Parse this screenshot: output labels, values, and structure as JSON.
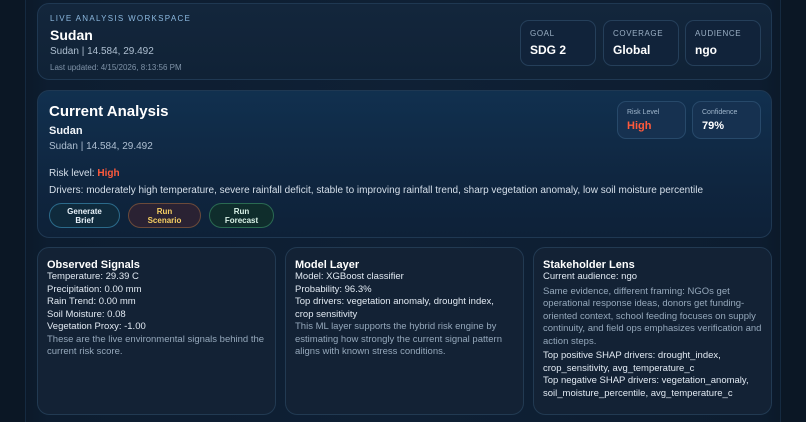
{
  "workspace": {
    "eyebrow": "LIVE ANALYSIS WORKSPACE",
    "title": "Sudan",
    "subtitle": "Sudan | 14.584, 29.492",
    "updated": "Last updated: 4/15/2026, 8:13:56 PM",
    "stats": [
      {
        "label": "GOAL",
        "value": "SDG 2"
      },
      {
        "label": "COVERAGE",
        "value": "Global"
      },
      {
        "label": "AUDIENCE",
        "value": "ngo"
      }
    ]
  },
  "analysis": {
    "title": "Current Analysis",
    "region": "Sudan",
    "subtitle": "Sudan | 14.584, 29.492",
    "risk_prefix": "Risk level: ",
    "risk_value": "High",
    "drivers": "Drivers: moderately high temperature, severe rainfall deficit, stable to improving rainfall trend, sharp vegetation anomaly, low soil moisture percentile",
    "risk_card": {
      "label": "Risk Level",
      "value": "High"
    },
    "confidence_card": {
      "label": "Confidence",
      "value": "79%"
    },
    "buttons": {
      "brief": "Generate Brief",
      "scenario": "Run Scenario",
      "forecast": "Run Forecast"
    }
  },
  "observed": {
    "title": "Observed Signals",
    "lines": [
      "Temperature: 29.39 C",
      "Precipitation: 0.00 mm",
      "Rain Trend: 0.00 mm",
      "Soil Moisture: 0.08",
      "Vegetation Proxy: -1.00"
    ],
    "note": "These are the live environmental signals behind the current risk score."
  },
  "model": {
    "title": "Model Layer",
    "model": "Model: XGBoost classifier",
    "probability": "Probability: 96.3%",
    "top_drivers": "Top drivers: vegetation anomaly, drought index, crop sensitivity",
    "note": "This ML layer supports the hybrid risk engine by estimating how strongly the current signal pattern aligns with known stress conditions."
  },
  "stakeholder": {
    "title": "Stakeholder Lens",
    "audience": "Current audience: ngo",
    "note": "Same evidence, different framing: NGOs get operational response ideas, donors get funding-oriented context, school feeding focuses on supply continuity, and field ops emphasizes verification and action steps.",
    "positive": "Top positive SHAP drivers: drought_index, crop_sensitivity, avg_temperature_c",
    "negative": "Top negative SHAP drivers: vegetation_anomaly, soil_moisture_percentile, avg_temperature_c"
  },
  "colors": {
    "risk_high": "#ff5a3c",
    "scenario_text": "#f6cf62",
    "accent_blue": "#8bb8de"
  }
}
